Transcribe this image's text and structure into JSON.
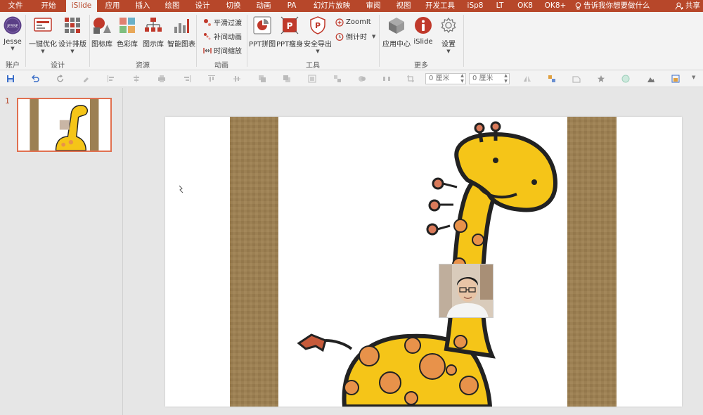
{
  "tabs": [
    "文件",
    "开始",
    "iSlide",
    "应用",
    "插入",
    "绘图",
    "设计",
    "切换",
    "动画",
    "PA",
    "幻灯片放映",
    "审阅",
    "视图",
    "开发工具",
    "iSp8",
    "LT",
    "OK8",
    "OK8+"
  ],
  "active_tab": "iSlide",
  "tell_me": "告诉我你想要做什么",
  "share": "共享",
  "ribbon": {
    "account": {
      "label": "Jesse",
      "avatar_text": "JESSE",
      "group": "账户"
    },
    "design": {
      "btn1": "一键优化",
      "btn2": "设计排版",
      "group": "设计"
    },
    "resources": {
      "btn1": "图标库",
      "btn2": "色彩库",
      "btn3": "图示库",
      "btn4": "智能图表",
      "group": "资源"
    },
    "animation": {
      "btn1": "平滑过渡",
      "btn2": "补间动画",
      "btn3": "时间缩放",
      "group": "动画"
    },
    "tools": {
      "btn1": "PPT拼图",
      "btn2": "PPT瘦身",
      "btn3": "安全导出",
      "btn4": "ZoomIt",
      "btn5": "倒计时",
      "group": "工具"
    },
    "more": {
      "btn1": "应用中心",
      "btn2": "iSlide",
      "btn3": "设置",
      "group": "更多"
    }
  },
  "qat": {
    "width_value": "0 厘米",
    "height_value": "0 厘米"
  },
  "slides": {
    "current_number": "1"
  },
  "colors": {
    "accent": "#b7472a",
    "ribbon_bg": "#f3f3f3",
    "giraffe_yellow": "#f5c518",
    "spot_orange": "#e8924a"
  }
}
